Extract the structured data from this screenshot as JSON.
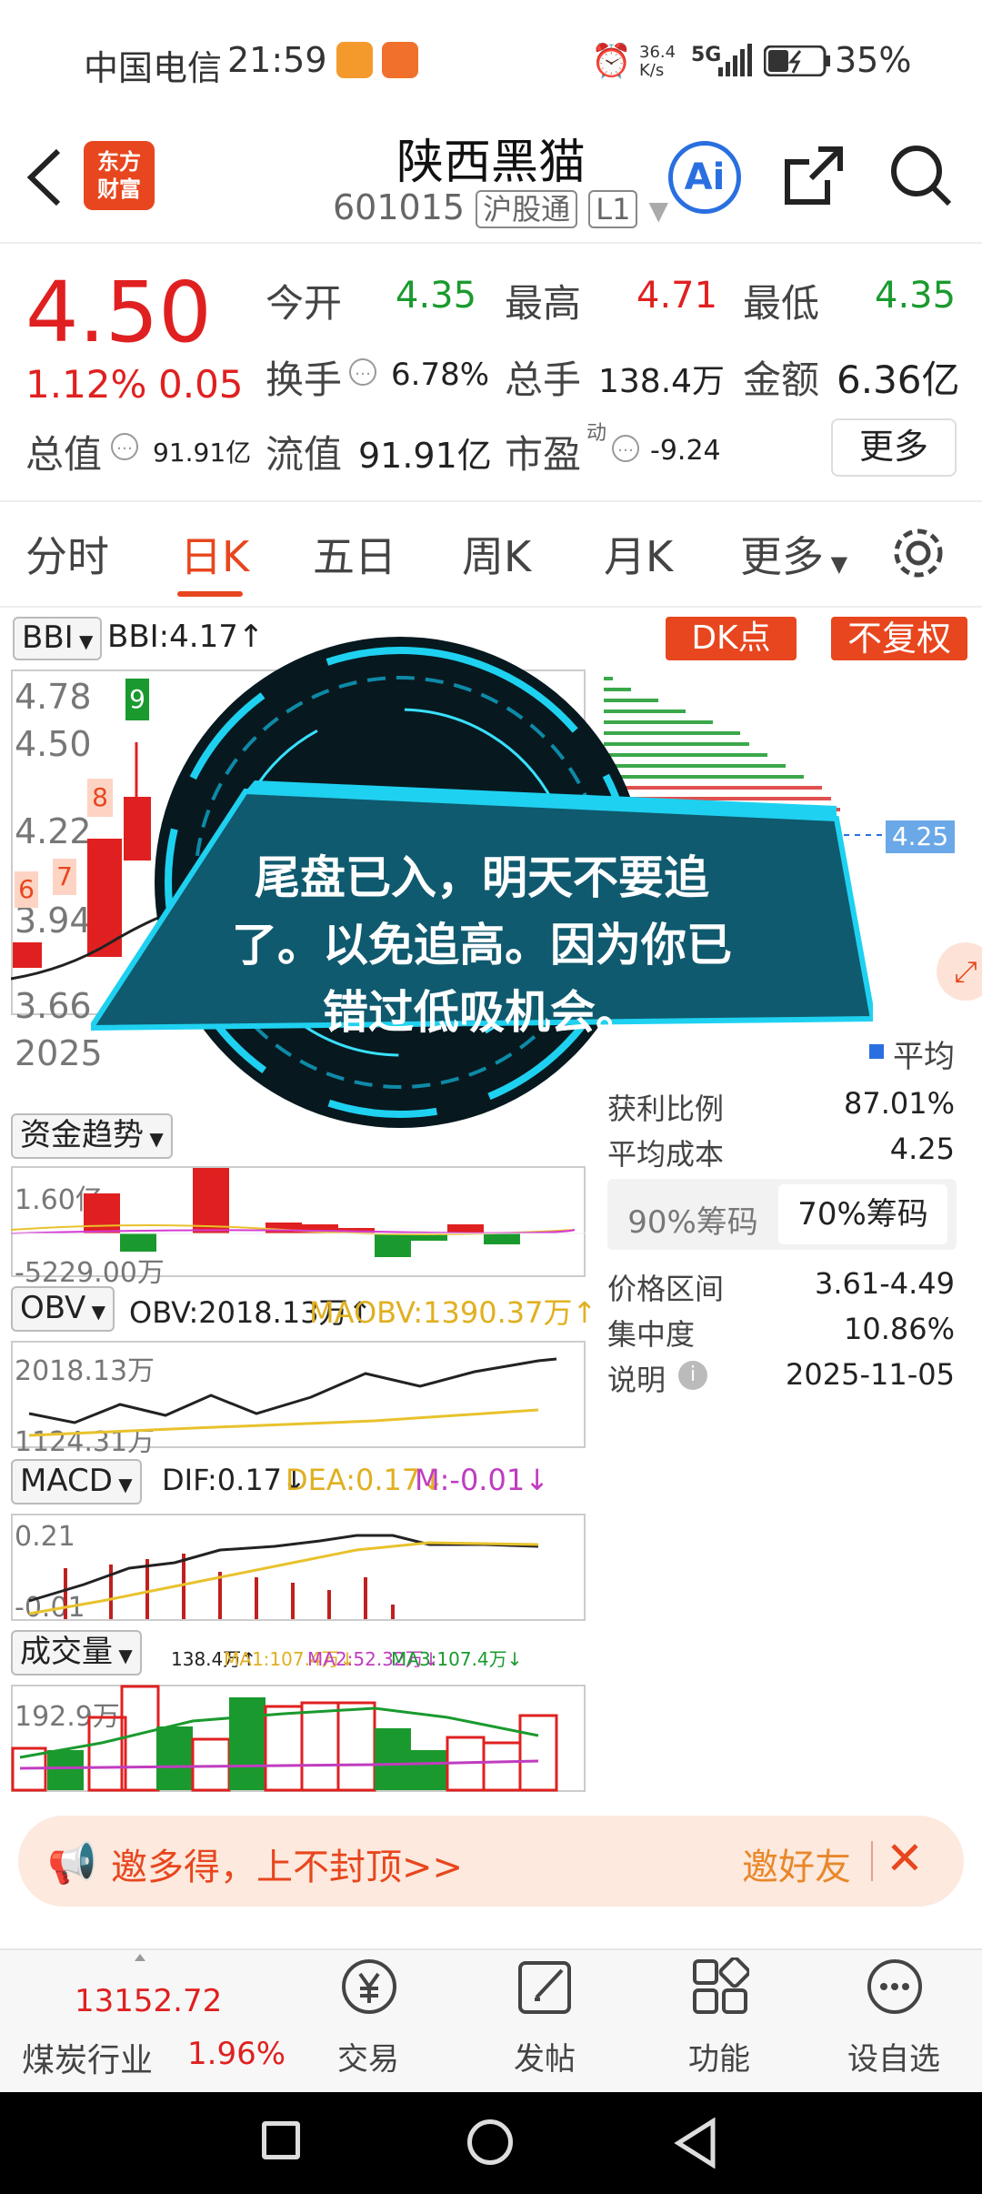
{
  "status": {
    "carrier": "中国电信",
    "time": "21:59",
    "net_speed": "36.4",
    "net_unit": "K/s",
    "signal": "5G",
    "battery": "35%"
  },
  "header": {
    "stock_name": "陕西黑猫",
    "code": "601015",
    "tag1": "沪股通",
    "tag2": "L1",
    "ai_label": "Ai",
    "logo_l1": "东方",
    "logo_l2": "财富"
  },
  "quote": {
    "price": "4.50",
    "pct": "1.12%",
    "chg": "0.05",
    "open_label": "今开",
    "open": "4.35",
    "high_label": "最高",
    "high": "4.71",
    "low_label": "最低",
    "low": "4.35",
    "turnover_label": "换手",
    "turnover": "6.78%",
    "volume_label": "总手",
    "volume": "138.4万",
    "amount_label": "金额",
    "amount": "6.36亿",
    "mcap_label": "总值",
    "mcap": "91.91亿",
    "float_label": "流值",
    "float": "91.91亿",
    "pe_label": "市盈",
    "pe_sup": "动",
    "pe": "-9.24",
    "more": "更多"
  },
  "tabs": [
    "分时",
    "日K",
    "五日",
    "周K",
    "月K",
    "更多"
  ],
  "kline": {
    "indicator": "BBI",
    "bbi": "BBI:4.17↑",
    "dk_btn": "DK点",
    "fq_btn": "不复权",
    "y_labels": [
      "4.78",
      "4.50",
      "4.22",
      "3.94",
      "3.66"
    ],
    "date_prefix": "2025",
    "marker9": "9",
    "marker8": "8",
    "marker7": "7",
    "marker6": "6",
    "cost_tag": "4.25"
  },
  "chips": {
    "legend": "平均",
    "profit_label": "获利比例",
    "profit": "87.01%",
    "avg_cost_label": "平均成本",
    "avg_cost": "4.25",
    "tab90": "90%筹码",
    "tab70": "70%筹码",
    "range_label": "价格区间",
    "range": "3.61-4.49",
    "conc_label": "集中度",
    "conc": "10.86%",
    "note_label": "说明",
    "note": "2025-11-05"
  },
  "fund": {
    "label": "资金趋势",
    "top": "1.60亿",
    "bottom": "-5229.00万"
  },
  "obv": {
    "label": "OBV",
    "obv": "OBV:2018.13万↑",
    "maobv": "MAOBV:1390.37万↑",
    "top": "2018.13万",
    "bottom": "1124.31万"
  },
  "macd": {
    "label": "MACD",
    "dif": "DIF:0.17↓",
    "dea": "DEA:0.17↓",
    "m": "M:-0.01↓",
    "top": "0.21",
    "bottom": "-0.01"
  },
  "vol": {
    "label": "成交量",
    "v": "138.4万↑",
    "ma1": "MA1:107.4万↓",
    "ma2": "MA2:52.32万↓",
    "ma3": "MA3:107.4万↓",
    "top": "192.9万"
  },
  "overlay": {
    "line1": "尾盘已入，明天不要追",
    "line2": "了。以免追高。因为你已",
    "line3": "错过低吸机会。"
  },
  "banner": {
    "text": "邀多得，上不封顶>>",
    "invite": "邀好友"
  },
  "bottomnav": {
    "index": "13152.72",
    "sector": "煤炭行业",
    "sector_pct": "1.96%",
    "trade": "交易",
    "post": "发帖",
    "func": "功能",
    "watch": "设自选"
  },
  "colors": {
    "up": "#e02020",
    "down": "#1a9a2e",
    "accent": "#e8461e",
    "overlay": "#0f5a6e"
  }
}
